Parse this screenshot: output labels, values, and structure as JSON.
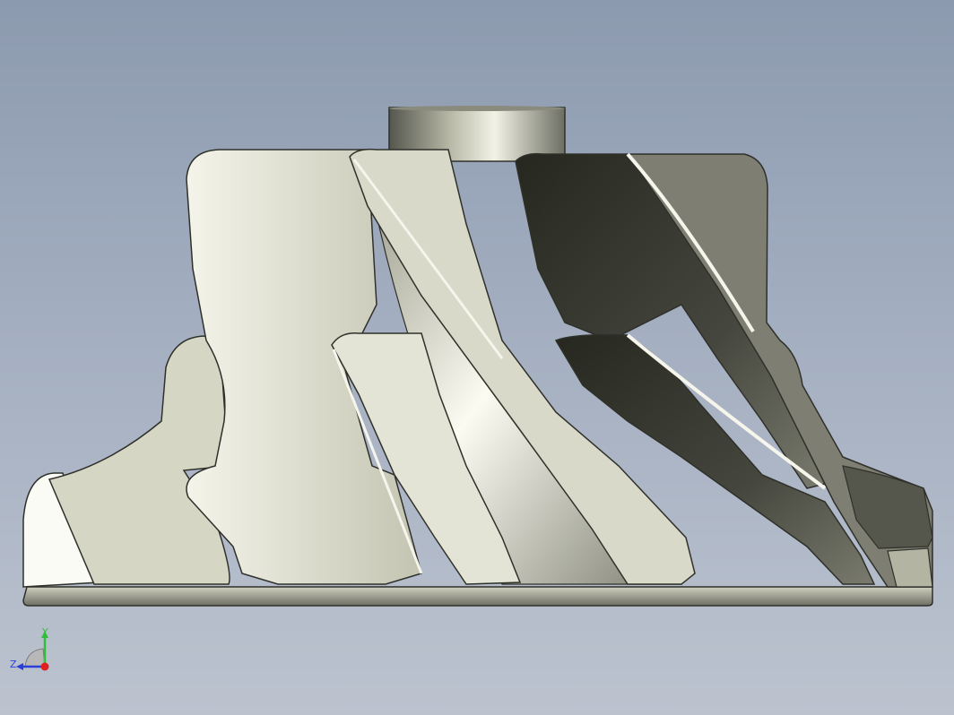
{
  "viewport": {
    "background_top": "#8c9aaf",
    "background_bottom": "#bcc3cf"
  },
  "model": {
    "name_icon": "compressor-impeller-icon",
    "metal_light": "#e9e9dc",
    "metal_mid": "#c9c9b8",
    "metal_dark": "#3e3f37"
  },
  "triad": {
    "x_label": "",
    "y_label": "Y",
    "z_label": "Z",
    "y_color": "#2fbf3a",
    "z_color": "#2a3fd8",
    "x_color": "#e02020"
  }
}
